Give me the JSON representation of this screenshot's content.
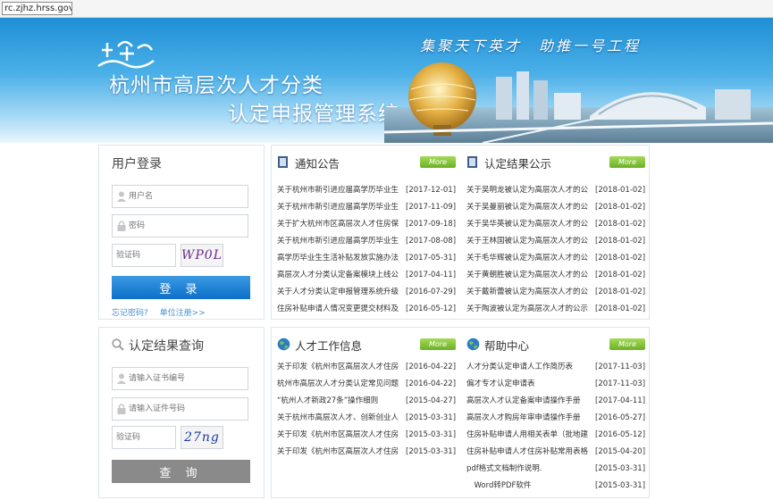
{
  "browser": {
    "url": "rc.zjhz.hrss.gov.cn"
  },
  "banner": {
    "title_line1": "杭州市高层次人才分类",
    "title_line2": "认定申报管理系统",
    "slogan": "集聚天下英才　助推一号工程"
  },
  "login": {
    "title": "用户登录",
    "username_placeholder": "用户名",
    "password_placeholder": "密码",
    "captcha_placeholder": "验证码",
    "captcha_text": "WP0L",
    "button_label": "登 录",
    "forgot_label": "忘记密码?",
    "register_label": "单位注册>>"
  },
  "query": {
    "title": "认定结果查询",
    "cert_placeholder": "请输入证书编号",
    "id_placeholder": "请输入证件号码",
    "captcha_placeholder": "验证码",
    "captcha_text": "27ng",
    "button_label": "查 询"
  },
  "more_label": "More",
  "notice": {
    "title": "通知公告",
    "items": [
      {
        "title": "关于杭州市新引进应届高学历毕业生",
        "date": "[2017-12-01]"
      },
      {
        "title": "关于杭州市新引进应届高学历毕业生",
        "date": "[2017-11-09]"
      },
      {
        "title": "关于扩大杭州市区高层次人才住房保",
        "date": "[2017-09-18]"
      },
      {
        "title": "关于杭州市新引进应届高学历毕业生",
        "date": "[2017-08-08]"
      },
      {
        "title": "高学历毕业生生活补贴发放实施办法",
        "date": "[2017-05-31]"
      },
      {
        "title": "高层次人才分类认定备案模块上线公",
        "date": "[2017-04-11]"
      },
      {
        "title": "关于人才分类认定申报管理系统升级",
        "date": "[2016-07-29]"
      },
      {
        "title": "住房补贴申请人情况变更提交材料及",
        "date": "[2016-05-12]"
      }
    ]
  },
  "results": {
    "title": "认定结果公示",
    "items": [
      {
        "title": "关于吴明龙被认定为高层次人才的公",
        "date": "[2018-01-02]"
      },
      {
        "title": "关于吴曼丽被认定为高层次人才的公",
        "date": "[2018-01-02]"
      },
      {
        "title": "关于吴华英被认定为高层次人才的公",
        "date": "[2018-01-02]"
      },
      {
        "title": "关于王林国被认定为高层次人才的公",
        "date": "[2018-01-02]"
      },
      {
        "title": "关于毛华辉被认定为高层次人才的公",
        "date": "[2018-01-02]"
      },
      {
        "title": "关于黄朝胜被认定为高层次人才的公",
        "date": "[2018-01-02]"
      },
      {
        "title": "关于戴新蕾被认定为高层次人才的公",
        "date": "[2018-01-02]"
      },
      {
        "title": "关于陶波被认定为高层次人才的公示",
        "date": "[2018-01-02]"
      }
    ]
  },
  "talent_info": {
    "title": "人才工作信息",
    "items": [
      {
        "title": "关于印发《杭州市区高层次人才住房",
        "date": "[2016-04-22]"
      },
      {
        "title": "杭州市高层次人才分类认定常见问题",
        "date": "[2016-04-22]"
      },
      {
        "title": "“杭州人才新政27条”操作细则",
        "date": "[2015-04-27]"
      },
      {
        "title": "关于杭州市高层次人才、创新创业人",
        "date": "[2015-03-31]"
      },
      {
        "title": "关于印发《杭州市区高层次人才住房",
        "date": "[2015-03-31]"
      },
      {
        "title": "关于印发《杭州市区高层次人才住房",
        "date": "[2015-03-31]"
      }
    ]
  },
  "help": {
    "title": "帮助中心",
    "items": [
      {
        "title": "人才分类认定申请人工作简历表",
        "date": "[2017-11-03]"
      },
      {
        "title": "偏才专才认定申请表",
        "date": "[2017-11-03]"
      },
      {
        "title": "高层次人才认定备案申请操作手册",
        "date": "[2017-04-11]"
      },
      {
        "title": "高层次人才购房年审申请操作手册",
        "date": "[2016-05-27]"
      },
      {
        "title": "住房补贴申请人用相关表单（批地建",
        "date": "[2016-05-12]"
      },
      {
        "title": "住房补贴申请人才住房补贴常用表格",
        "date": "[2015-04-20]"
      },
      {
        "title": "pdf格式文档制作说明.",
        "date": "[2015-03-31]"
      },
      {
        "title": "　Word转PDF软件",
        "date": "[2015-03-31]"
      }
    ]
  }
}
